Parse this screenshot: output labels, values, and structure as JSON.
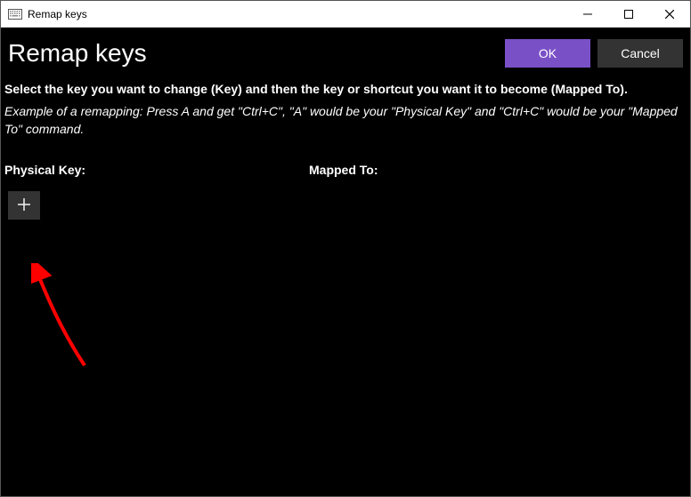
{
  "titlebar": {
    "title": "Remap keys"
  },
  "header": {
    "page_title": "Remap keys",
    "ok_label": "OK",
    "cancel_label": "Cancel"
  },
  "instructions": {
    "main": "Select the key you want to change (Key) and then the key or shortcut you want it to become (Mapped To).",
    "example": "Example of a remapping: Press A and get \"Ctrl+C\", \"A\" would be your \"Physical Key\" and \"Ctrl+C\" would be your \"Mapped To\" command."
  },
  "columns": {
    "physical_key": "Physical Key:",
    "mapped_to": "Mapped To:"
  },
  "colors": {
    "primary": "#7a50c7",
    "secondary": "#333333"
  }
}
